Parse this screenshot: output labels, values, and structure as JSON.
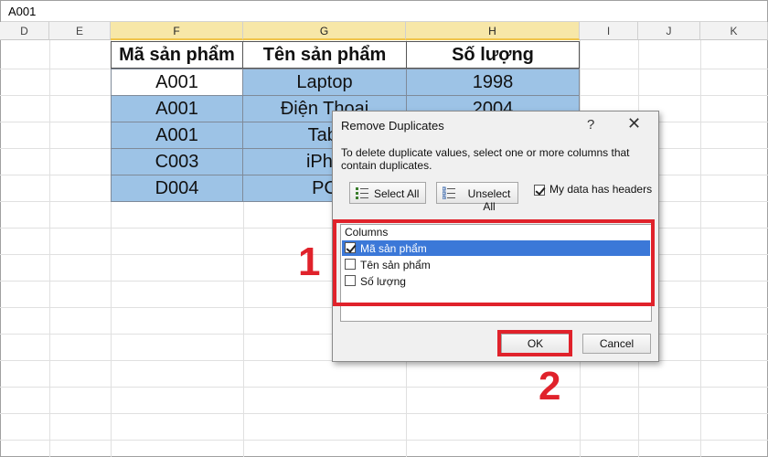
{
  "formula_bar": {
    "value": "A001"
  },
  "columns": {
    "D": "D",
    "E": "E",
    "F": "F",
    "G": "G",
    "H": "H",
    "I": "I",
    "J": "J",
    "K": "K"
  },
  "table": {
    "headers": [
      "Mã sản phẩm",
      "Tên sản phẩm",
      "Số lượng"
    ],
    "rows": [
      [
        "A001",
        "Laptop",
        "1998"
      ],
      [
        "A001",
        "Điện Thoại",
        "2004"
      ],
      [
        "A001",
        "Tabl",
        ""
      ],
      [
        "C003",
        "iPho",
        ""
      ],
      [
        "D004",
        "PC",
        ""
      ]
    ]
  },
  "dialog": {
    "title": "Remove Duplicates",
    "help": "?",
    "close": "✕",
    "description": "To delete duplicate values, select one or more columns that contain duplicates.",
    "select_all_label": "Select All",
    "unselect_all_label": "Unselect All",
    "headers_checkbox_label": "My data has headers",
    "headers_checked": true,
    "columns_group_label": "Columns",
    "column_items": [
      {
        "label": "Mã sản phẩm",
        "checked": true
      },
      {
        "label": "Tên sản phẩm",
        "checked": false
      },
      {
        "label": "Số lượng",
        "checked": false
      }
    ],
    "ok_label": "OK",
    "cancel_label": "Cancel"
  },
  "annotations": {
    "step1": "1",
    "step2": "2"
  },
  "colors": {
    "accent_red": "#e0222b",
    "cell_blue": "#9dc3e6",
    "selection_blue": "#3b78d8"
  }
}
